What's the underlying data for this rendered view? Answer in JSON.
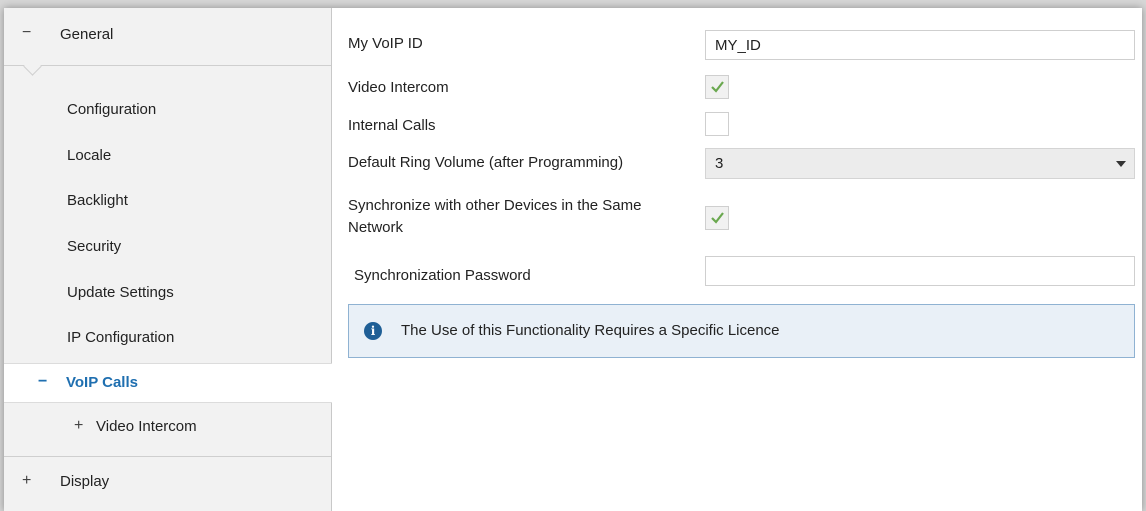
{
  "sidebar": {
    "general": {
      "sign": "−",
      "label": "General"
    },
    "sub_items": [
      {
        "label": "Configuration"
      },
      {
        "label": "Locale"
      },
      {
        "label": "Backlight"
      },
      {
        "label": "Security"
      },
      {
        "label": "Update Settings"
      },
      {
        "label": "IP Configuration"
      }
    ],
    "voip": {
      "sign": "−",
      "label": "VoIP Calls"
    },
    "video_intercom": {
      "sign": "+",
      "label": "Video Intercom"
    },
    "display": {
      "sign": "+",
      "label": "Display"
    }
  },
  "form": {
    "voip_id": {
      "label": "My VoIP ID",
      "value": "MY_ID"
    },
    "video_intercom": {
      "label": "Video Intercom",
      "checked": true
    },
    "internal_calls": {
      "label": "Internal Calls",
      "checked": false
    },
    "ring_volume": {
      "label": "Default Ring Volume (after Programming)",
      "value": "3"
    },
    "sync": {
      "label_line1": "Synchronize with other Devices in the Same",
      "label_line2": "Network",
      "checked": true
    },
    "sync_password": {
      "label": "Synchronization Password",
      "value": ""
    }
  },
  "info": {
    "text": "The Use of this Functionality Requires a Specific Licence"
  },
  "colors": {
    "accent": "#1f6fb0",
    "check": "#6aa84f",
    "info_bg": "#e9f0f7"
  }
}
